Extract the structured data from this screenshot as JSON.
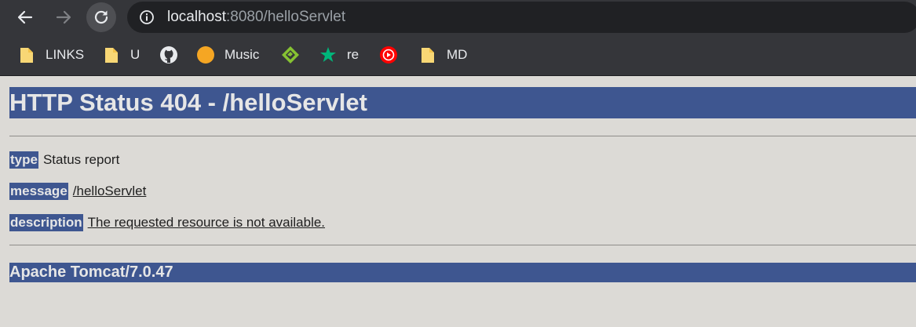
{
  "browser": {
    "url_host": "localhost",
    "url_rest": ":8080/helloServlet"
  },
  "bookmarks": [
    {
      "label": "LINKS",
      "icon": "folder-icon"
    },
    {
      "label": "U",
      "icon": "folder-icon"
    },
    {
      "label": "",
      "icon": "github-icon"
    },
    {
      "label": "Music",
      "icon": "orange-circle-icon"
    },
    {
      "label": "",
      "icon": "green-diamond-icon"
    },
    {
      "label": "re",
      "icon": "green-star-icon"
    },
    {
      "label": "",
      "icon": "youtube-music-icon"
    },
    {
      "label": "MD",
      "icon": "folder-icon"
    }
  ],
  "page": {
    "heading": "HTTP Status 404 - /helloServlet",
    "rows": [
      {
        "key": "type",
        "value": "Status report"
      },
      {
        "key": "message",
        "value": "/helloServlet"
      },
      {
        "key": "description",
        "value": "The requested resource is not available."
      }
    ],
    "footer": "Apache Tomcat/7.0.47"
  },
  "colors": {
    "heading_bg": "#3e5690",
    "page_bg": "#dcdad6",
    "toolbar_bg": "#35363a"
  }
}
